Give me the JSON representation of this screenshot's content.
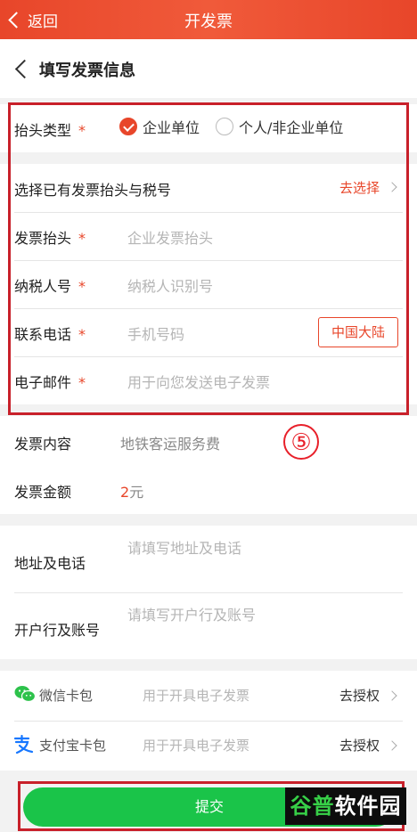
{
  "nav": {
    "back_label": "返回",
    "title": "开发票"
  },
  "subheader": {
    "title": "填写发票信息"
  },
  "invoice_form": {
    "header_type": {
      "label": "抬头类型",
      "required_mark": "*",
      "option_company": "企业单位",
      "option_personal": "个人/非企业单位",
      "selected": "企业单位"
    },
    "select_existing": {
      "label": "选择已有发票抬头与税号",
      "action": "去选择"
    },
    "invoice_title": {
      "label": "发票抬头",
      "required_mark": "*",
      "placeholder": "企业发票抬头"
    },
    "tax_id": {
      "label": "纳税人号",
      "required_mark": "*",
      "placeholder": "纳税人识别号"
    },
    "phone": {
      "label": "联系电话",
      "required_mark": "*",
      "placeholder": "手机号码",
      "region_button": "中国大陆"
    },
    "email": {
      "label": "电子邮件",
      "required_mark": "*",
      "placeholder": "用于向您发送电子发票"
    }
  },
  "annotation": {
    "step_marker": "⑤"
  },
  "invoice_details": {
    "content": {
      "label": "发票内容",
      "value": "地铁客运服务费"
    },
    "amount": {
      "label": "发票金额",
      "value": "2",
      "unit": "元"
    }
  },
  "extra": {
    "address": {
      "label": "地址及电话",
      "placeholder": "请填写地址及电话"
    },
    "bank": {
      "label": "开户行及账号",
      "placeholder": "请填写开户行及账号"
    }
  },
  "wallets": {
    "wechat": {
      "label": "微信卡包",
      "desc": "用于开具电子发票",
      "action": "去授权"
    },
    "alipay": {
      "label": "支付宝卡包",
      "desc": "用于开具电子发票",
      "action": "去授权"
    }
  },
  "submit": {
    "label": "提交"
  },
  "watermark": {
    "part1": "谷普",
    "part2": "软件园"
  },
  "colors": {
    "accent": "#e8462a",
    "submit_green": "#1ac449",
    "highlight_frame": "#c8202a"
  }
}
